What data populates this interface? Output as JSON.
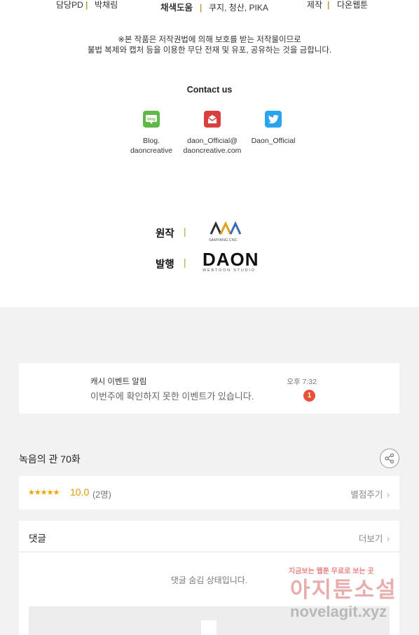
{
  "credits": {
    "pd_label": "담당PD",
    "pd_name": "박채림",
    "color_label": "채색도움",
    "color_names": "쿠지, 청산, PIKA",
    "production_label": "제작",
    "production_name": "다온웹툰",
    "copyright_line1": "※본 작품은 저작권법에 의해 보호를 받는 저작물이므로",
    "copyright_line2": "불법 복제와 캡처 등을 이용한 무단 전재 및 유포, 공유하는 것을 금합니다.",
    "contact_title": "Contact us",
    "contacts": [
      {
        "icon": "blog-icon",
        "line1": "Blog.",
        "line2": "daoncreative"
      },
      {
        "icon": "mail-icon",
        "line1": "daon_Official@",
        "line2": "daoncreative.com"
      },
      {
        "icon": "twitter-icon",
        "line1": "Daon_Official",
        "line2": ""
      }
    ],
    "origin_label": "원작",
    "origin_logo_text": "SAMYANG CNC",
    "publisher_label": "발행",
    "publisher_logo": "DAON",
    "publisher_sub": "WEBTOON STUDIO",
    "separator": "|"
  },
  "notification": {
    "title": "캐시 이벤트 알림",
    "message": "이번주에 확인하지 못한 이벤트가 있습니다.",
    "time": "오후 7:32",
    "badge": "1"
  },
  "episode": {
    "title": "녹음의 관 70화"
  },
  "rating": {
    "stars": "★★★★★",
    "score": "10.0",
    "count": "(2명)",
    "rate_link": "별점주기"
  },
  "comments": {
    "label": "댓글",
    "more": "더보기",
    "hidden_message": "댓글 숨김 상태입니다."
  },
  "watermark": {
    "small": "지금보는 웹툰 무료로 보는 곳",
    "big": "아지툰소설",
    "url": "novelagit.xyz"
  },
  "colors": {
    "accent_bar": "#b5a33a",
    "rating": "#e59a00",
    "badge": "#e9503a",
    "background_gray": "#f2f2f2"
  }
}
